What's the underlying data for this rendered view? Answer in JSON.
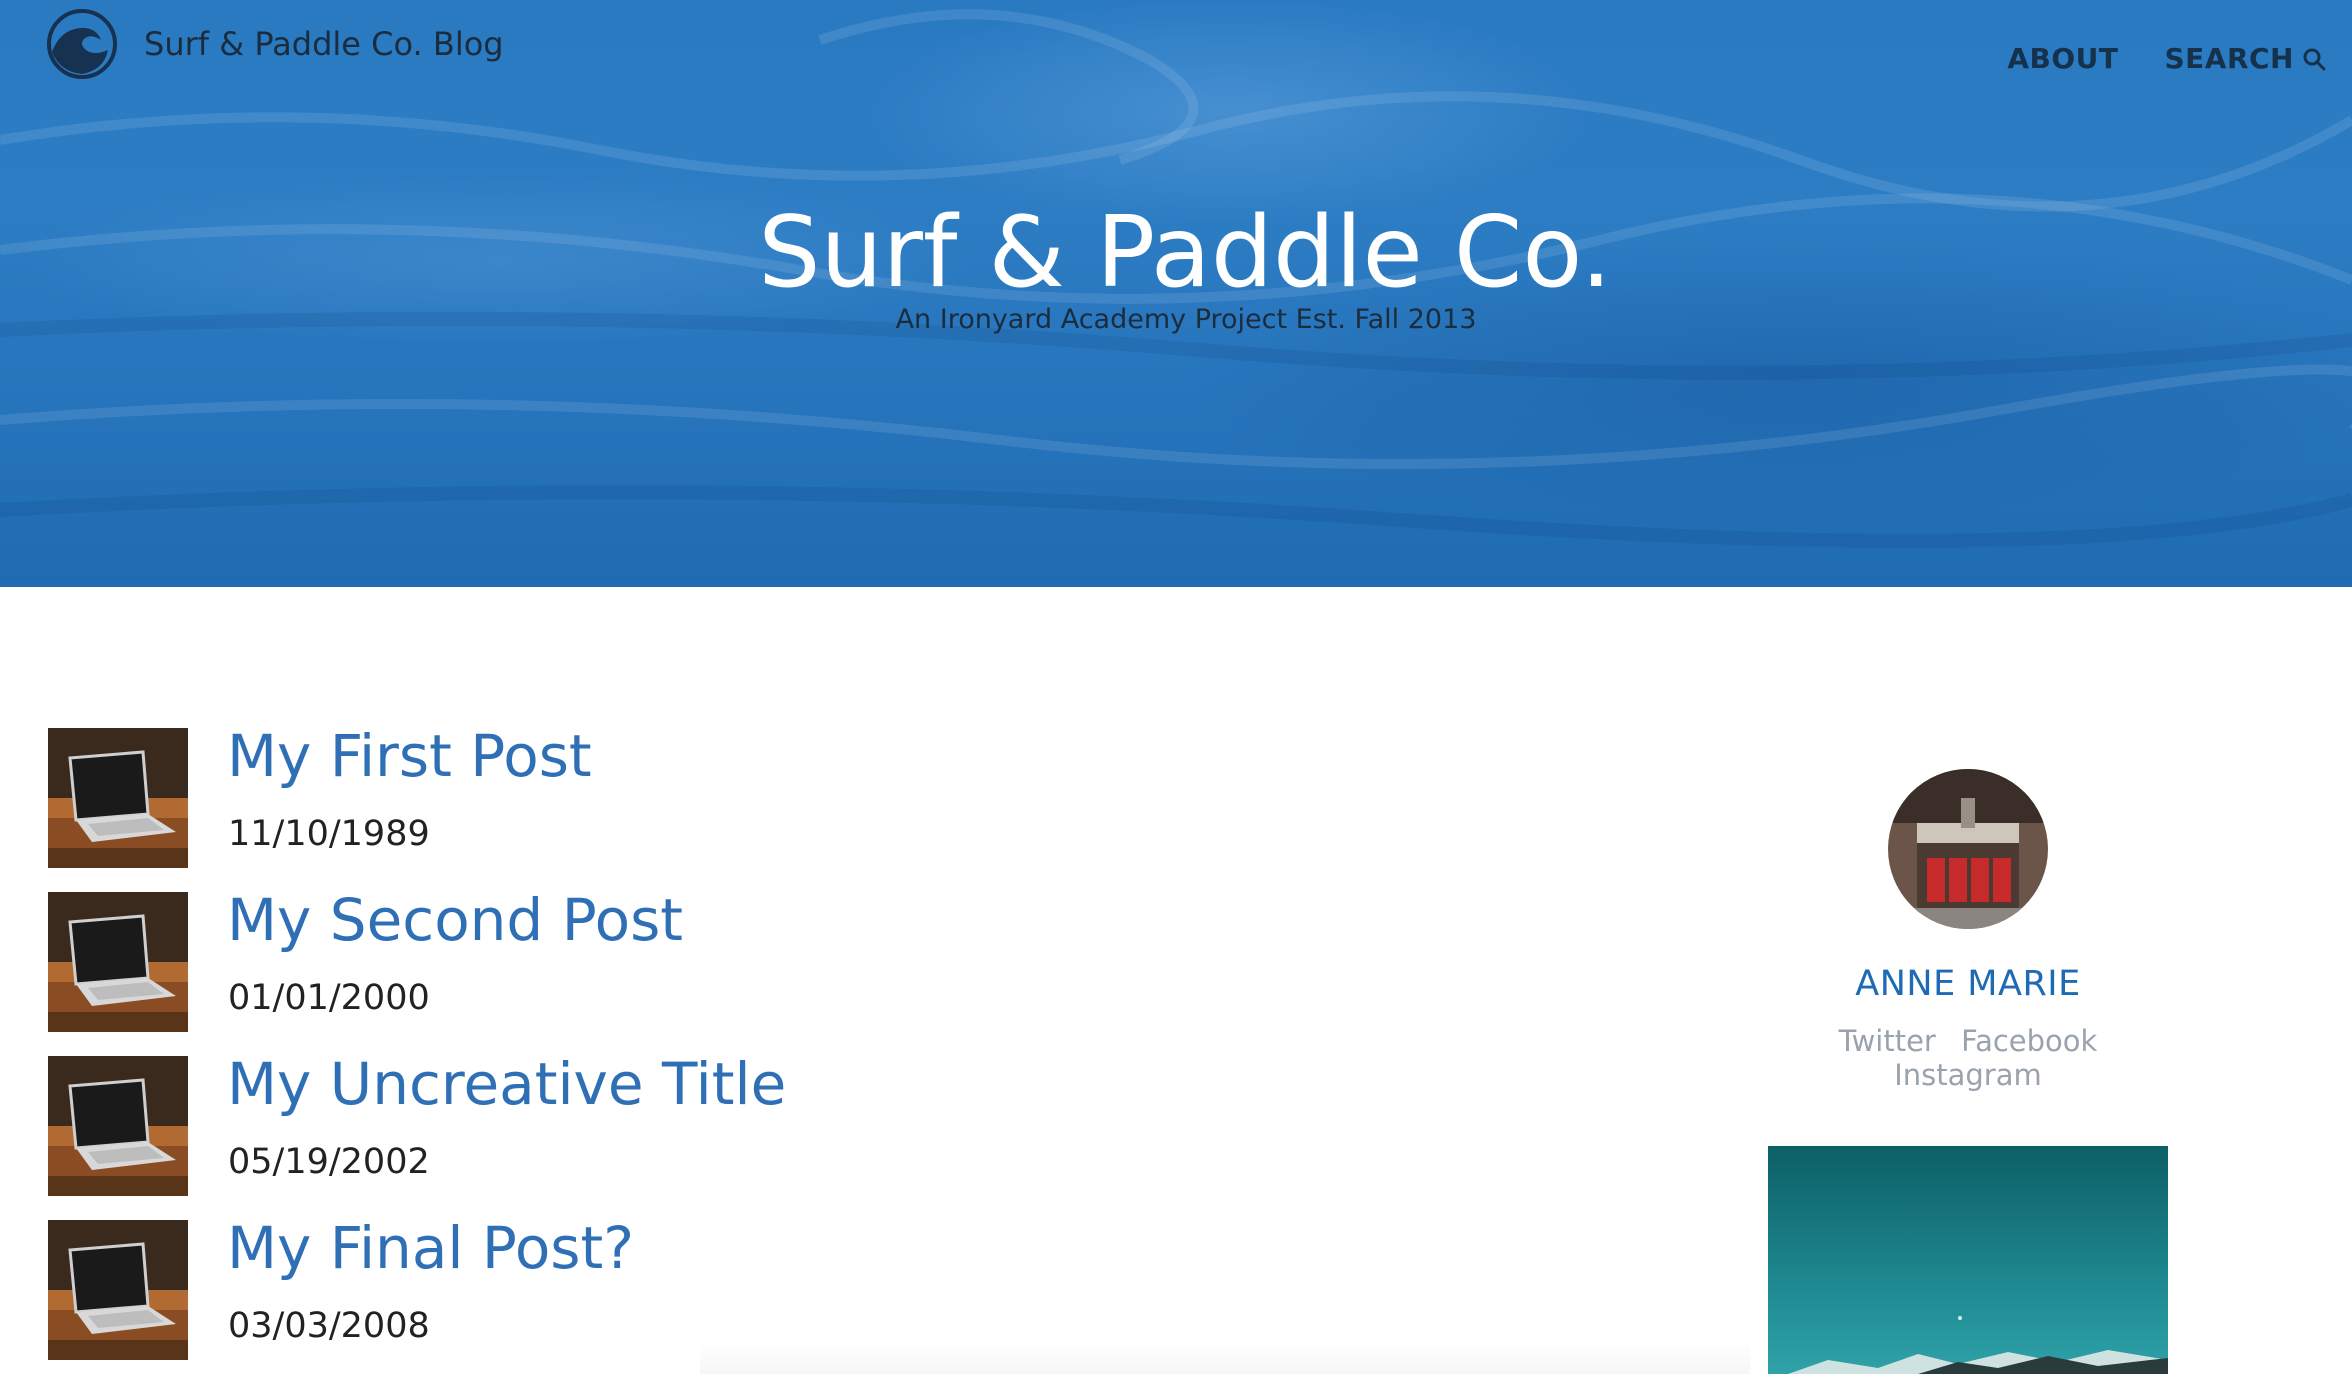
{
  "header": {
    "brand": "Surf & Paddle Co. Blog",
    "nav": {
      "about": "ABOUT",
      "search": "SEARCH"
    },
    "title": "Surf & Paddle Co.",
    "subtitle": "An Ironyard Academy Project Est. Fall 2013"
  },
  "posts": [
    {
      "title": "My First Post",
      "date": "11/10/1989"
    },
    {
      "title": "My Second Post",
      "date": "01/01/2000"
    },
    {
      "title": "My Uncreative Title",
      "date": "05/19/2002"
    },
    {
      "title": "My Final Post?",
      "date": "03/03/2008"
    }
  ],
  "sidebar": {
    "author": "ANNE MARIE",
    "social": [
      "Twitter",
      "Facebook",
      "Instagram"
    ]
  },
  "colors": {
    "hero_blue": "#2a7ac2",
    "link_blue": "#2f6fb5",
    "nav_dark": "#16314c",
    "muted_gray": "#9aa3ad"
  }
}
